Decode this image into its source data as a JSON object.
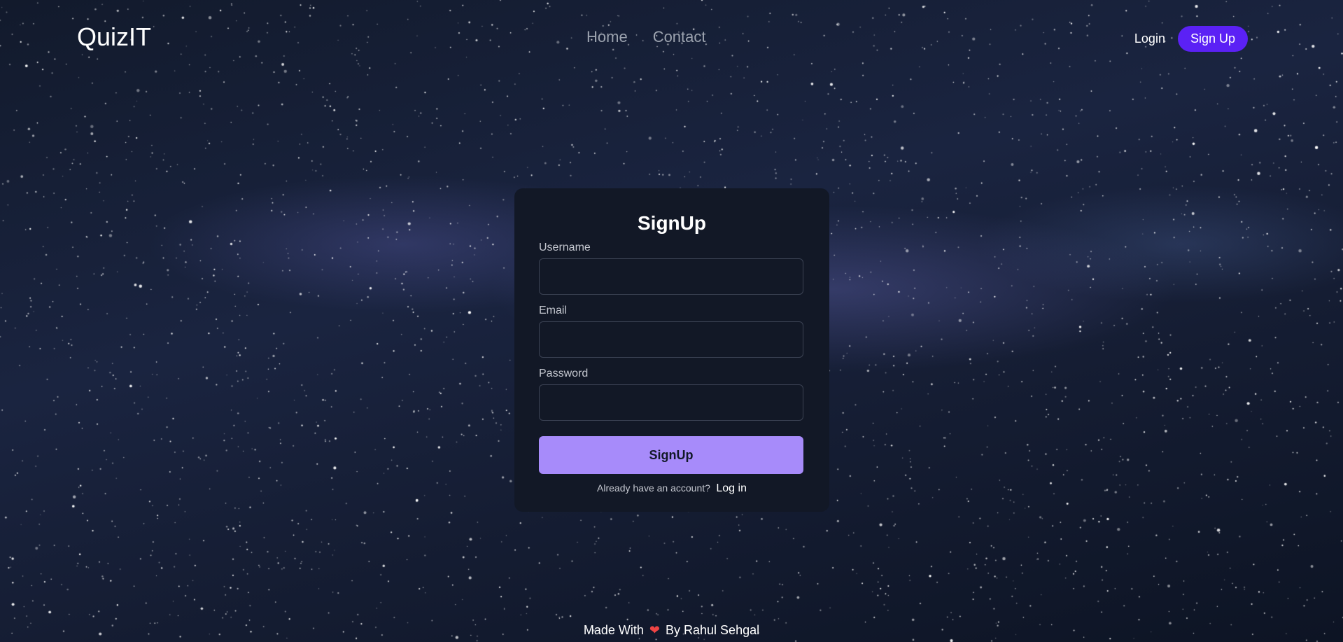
{
  "navbar": {
    "brand": "QuizIT",
    "links": [
      {
        "label": "Home"
      },
      {
        "label": "Contact"
      }
    ],
    "login_label": "Login",
    "signup_label": "Sign Up"
  },
  "signup_form": {
    "title": "SignUp",
    "username_label": "Username",
    "username_value": "",
    "email_label": "Email",
    "email_value": "",
    "password_label": "Password",
    "password_value": "",
    "submit_label": "SignUp",
    "switch_prompt": "Already have an account?",
    "switch_link": "Log in"
  },
  "footer": {
    "prefix": "Made With",
    "heart_icon": "❤",
    "suffix": "By Rahul Sehgal"
  },
  "colors": {
    "accent": "#5b21f5",
    "submit_button": "#a78bfa",
    "card_background": "#121826",
    "heart": "#ef4444"
  }
}
